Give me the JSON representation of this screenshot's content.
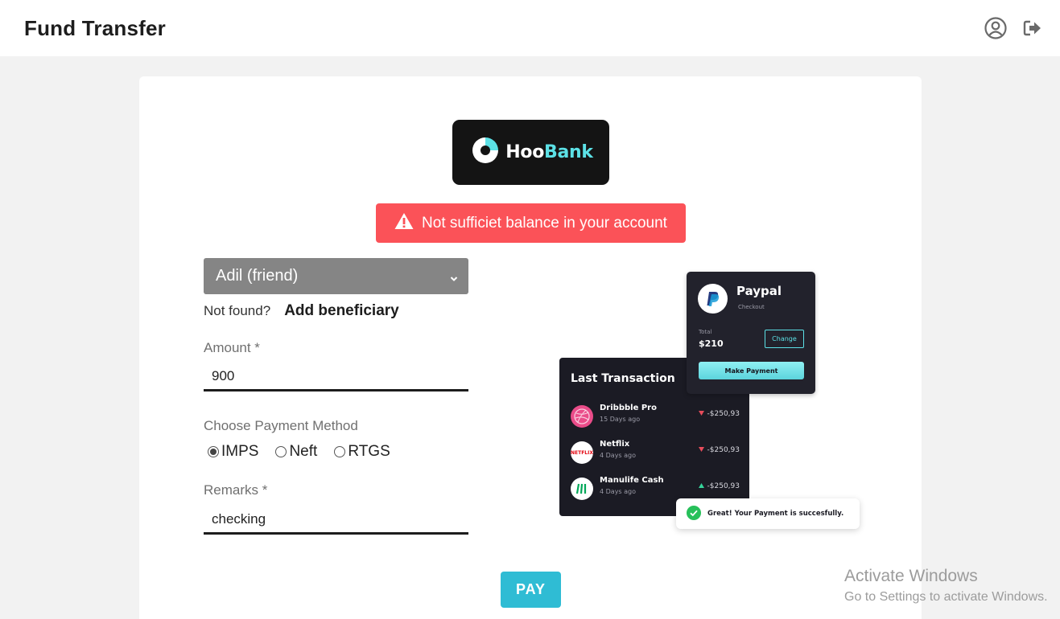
{
  "header": {
    "title": "Fund Transfer",
    "icons": [
      "user-circle-icon",
      "sign-out-icon"
    ]
  },
  "logo": {
    "text_part1": "Hoo",
    "text_part2": "Bank",
    "accent_color": "#5ce1e6"
  },
  "alert": {
    "icon": "warning-triangle-icon",
    "message": "Not sufficiet balance in your account",
    "color": "#fb5258"
  },
  "form": {
    "beneficiary": {
      "selected": "Adil (friend)"
    },
    "not_found_text": "Not found?",
    "add_beneficiary_label": "Add beneficiary",
    "amount": {
      "label": "Amount *",
      "value": "900"
    },
    "payment_method": {
      "label": "Choose Payment Method",
      "options": [
        {
          "label": "IMPS",
          "checked": true
        },
        {
          "label": "Neft",
          "checked": false
        },
        {
          "label": "RTGS",
          "checked": false
        }
      ]
    },
    "remarks": {
      "label": "Remarks *",
      "value": "checking"
    },
    "pay_label": "PAY",
    "pay_color": "#2fbcd4"
  },
  "illustration": {
    "last_transaction": {
      "title": "Last Transaction",
      "rows": [
        {
          "name": "Dribbble Pro",
          "sub": "15 Days ago",
          "amount": "-$250,93",
          "direction": "down",
          "icon": "dribbble-icon"
        },
        {
          "name": "Netflix",
          "sub": "4 Days ago",
          "amount": "-$250,93",
          "direction": "down",
          "icon": "netflix-icon",
          "icon_text": "NETFLIX"
        },
        {
          "name": "Manulife Cash",
          "sub": "4 Days ago",
          "amount": "-$250,93",
          "direction": "up",
          "icon": "manulife-icon"
        }
      ]
    },
    "paypal": {
      "name": "Paypal",
      "sub": "Checkout",
      "total_label": "Total",
      "total_value": "$210",
      "change_label": "Change",
      "make_payment_label": "Make Payment"
    },
    "toast": {
      "message": "Great! Your Payment is succesfully."
    }
  },
  "watermark": {
    "title": "Activate Windows",
    "subtitle": "Go to Settings to activate Windows."
  }
}
